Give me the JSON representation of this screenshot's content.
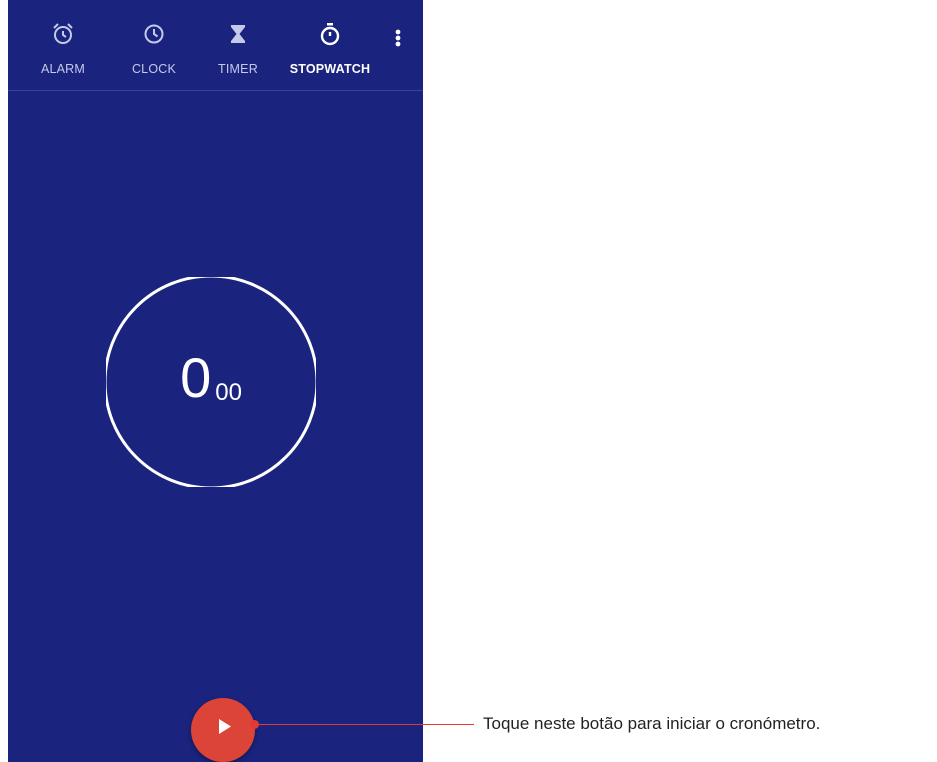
{
  "tabs": [
    {
      "label": "ALARM",
      "icon": "alarm-icon"
    },
    {
      "label": "CLOCK",
      "icon": "clock-icon"
    },
    {
      "label": "TIMER",
      "icon": "hourglass-icon"
    },
    {
      "label": "STOPWATCH",
      "icon": "stopwatch-icon",
      "active": true
    }
  ],
  "overflow_menu": {
    "icon": "more-vert-icon"
  },
  "stopwatch": {
    "seconds": "0",
    "hundredths": "00"
  },
  "start_button": {
    "icon": "play-icon"
  },
  "callout": {
    "text": "Toque neste botão para iniciar o cronómetro."
  },
  "colors": {
    "background": "#1a237e",
    "fab": "#db4437",
    "callout": "#e53935"
  }
}
